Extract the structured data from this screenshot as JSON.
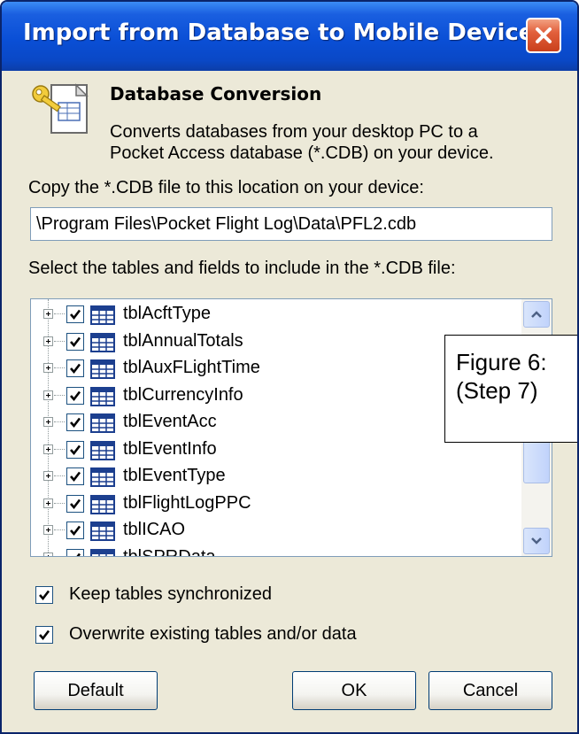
{
  "window": {
    "title": "Import from Database to Mobile Device"
  },
  "header": {
    "title": "Database Conversion",
    "description_line1": "Converts databases from your desktop PC to a",
    "description_line2": "Pocket Access database (*.CDB) on your device."
  },
  "location": {
    "label": "Copy the *.CDB file to this location on your device:",
    "value": "\\Program Files\\Pocket Flight Log\\Data\\PFL2.cdb"
  },
  "tables": {
    "label": "Select the tables and fields to include in the *.CDB file:",
    "items": [
      {
        "label": "tblAcftType",
        "checked": true
      },
      {
        "label": "tblAnnualTotals",
        "checked": true
      },
      {
        "label": "tblAuxFLightTime",
        "checked": true
      },
      {
        "label": "tblCurrencyInfo",
        "checked": true
      },
      {
        "label": "tblEventAcc",
        "checked": true
      },
      {
        "label": "tblEventInfo",
        "checked": true
      },
      {
        "label": "tblEventType",
        "checked": true
      },
      {
        "label": "tblFlightLogPPC",
        "checked": true
      },
      {
        "label": "tblICAO",
        "checked": true
      },
      {
        "label": "tblSPRData",
        "checked": true
      }
    ]
  },
  "annotation": {
    "line1": "Figure 6:",
    "line2": "(Step 7)"
  },
  "options": {
    "keep_synchronized": {
      "label": "Keep tables synchronized",
      "checked": true
    },
    "overwrite": {
      "label": "Overwrite existing tables and/or data",
      "checked": true
    }
  },
  "buttons": {
    "default": "Default",
    "ok": "OK",
    "cancel": "Cancel"
  },
  "colors": {
    "titlebar": "#0a4fd6",
    "dialog_bg": "#ece9d8",
    "close_button": "#e2603c"
  }
}
